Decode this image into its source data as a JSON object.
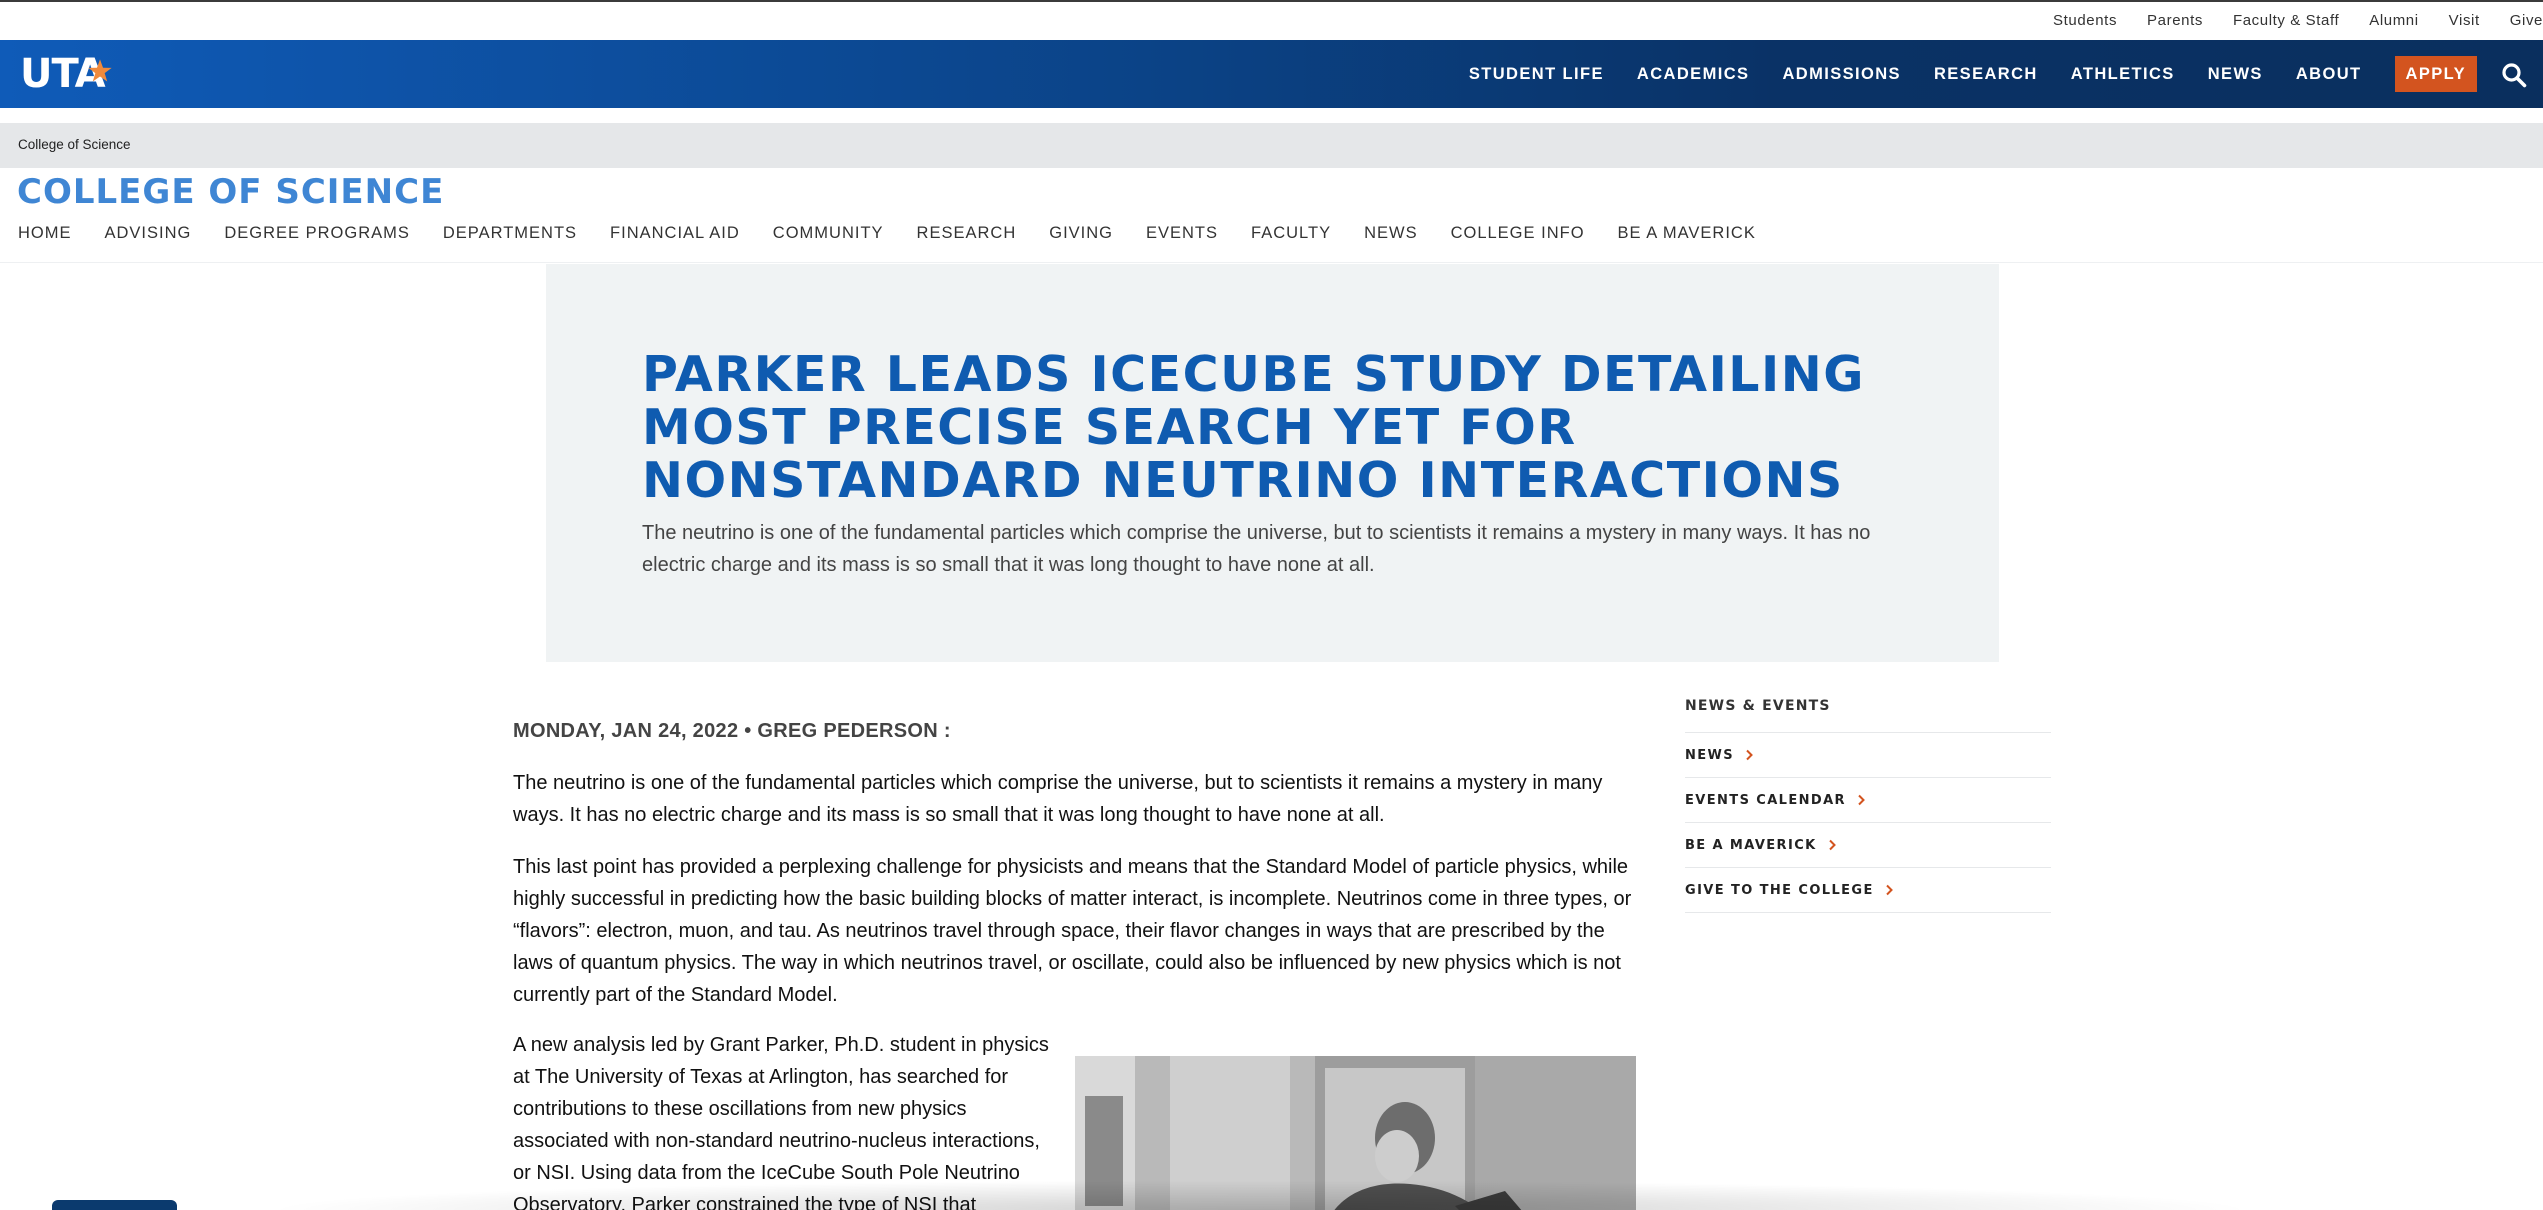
{
  "utility_nav": [
    "Students",
    "Parents",
    "Faculty & Staff",
    "Alumni",
    "Visit",
    "Give"
  ],
  "logo": {
    "text": "UTA",
    "icon": "star-icon"
  },
  "main_nav": {
    "items": [
      "STUDENT LIFE",
      "ACADEMICS",
      "ADMISSIONS",
      "RESEARCH",
      "ATHLETICS",
      "NEWS",
      "ABOUT"
    ],
    "apply_label": "APPLY",
    "search_icon": "search-icon"
  },
  "breadcrumb": {
    "current": "College of Science"
  },
  "college": {
    "title": "COLLEGE OF SCIENCE",
    "nav": [
      "HOME",
      "ADVISING",
      "DEGREE PROGRAMS",
      "DEPARTMENTS",
      "FINANCIAL AID",
      "COMMUNITY",
      "RESEARCH",
      "GIVING",
      "EVENTS",
      "FACULTY",
      "NEWS",
      "COLLEGE INFO",
      "BE A MAVERICK"
    ]
  },
  "hero": {
    "title": "PARKER LEADS ICECUBE STUDY DETAILING MOST PRECISE SEARCH YET FOR NONSTANDARD NEUTRINO INTERACTIONS",
    "summary": "The neutrino is one of the fundamental particles which comprise the universe, but to scientists it remains a mystery in many ways. It has no electric charge and its mass is so small that it was long thought to have none at all."
  },
  "article": {
    "byline": "MONDAY, JAN 24, 2022 • GREG PEDERSON :",
    "paragraphs": [
      "The neutrino is one of the fundamental particles which comprise the universe, but to scientists it remains a mystery in many ways. It has no electric charge and its mass is so small that it was long thought to have none at all.",
      "This last point has provided a perplexing challenge for physicists and means that the Standard Model of particle physics, while highly successful in predicting how the basic building blocks of matter interact, is incomplete. Neutrinos come in three types, or “flavors”: electron, muon, and tau. As neutrinos travel through space, their flavor changes in ways that are prescribed by the laws of quantum physics. The way in which neutrinos travel, or oscillate, could also be influenced by new physics which is not currently part of the Standard Model.",
      "A new analysis led by Grant Parker, Ph.D. student in physics at The University of Texas at Arlington, has searched for contributions to these oscillations from new physics associated with non-standard neutrino-nucleus interactions, or NSI. Using data from the IceCube South Pole Neutrino Observatory, Parker constrained the type of NSI that"
    ]
  },
  "sidebar": {
    "heading": "NEWS & EVENTS",
    "links": [
      "NEWS",
      "EVENTS CALENDAR",
      "BE A MAVERICK",
      "GIVE TO THE COLLEGE"
    ]
  },
  "colors": {
    "brand_blue": "#0f5bb0",
    "nav_dark": "#0a2f5e",
    "apply_orange": "#d3541f",
    "college_title": "#3f86d4",
    "chevron_red": "#d3541f"
  }
}
